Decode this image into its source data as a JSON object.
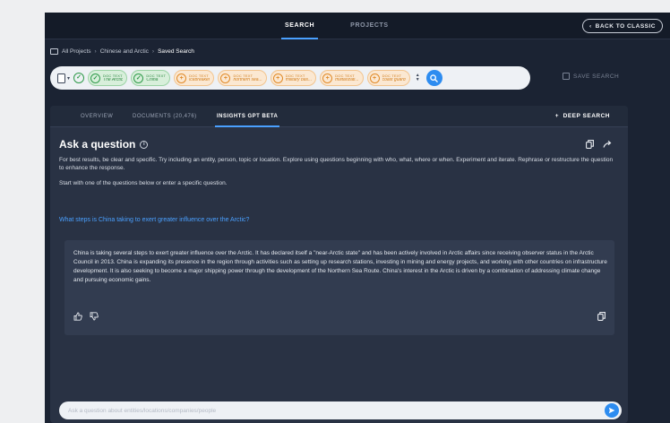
{
  "topnav": {
    "tabs": [
      {
        "label": "SEARCH",
        "active": true
      },
      {
        "label": "PROJECTS",
        "active": false
      }
    ],
    "back_to_classic": "BACK TO CLASSIC"
  },
  "breadcrumb": {
    "items": [
      "All Projects",
      "Chinese and Arctic",
      "Saved Search"
    ]
  },
  "querybar": {
    "chips": [
      {
        "category": "DOC TEXT",
        "value": "The Arctic",
        "color": "green"
      },
      {
        "category": "DOC TEXT",
        "value": "China",
        "color": "green"
      },
      {
        "category": "DOC TEXT",
        "value": "icebreaker",
        "color": "orange"
      },
      {
        "category": "DOC TEXT",
        "value": "northern sea...",
        "color": "orange"
      },
      {
        "category": "DOC TEXT",
        "value": "military bas...",
        "color": "orange"
      },
      {
        "category": "DOC TEXT",
        "value": "militarizati...",
        "color": "orange"
      },
      {
        "category": "DOC TEXT",
        "value": "coast guard",
        "color": "orange"
      }
    ],
    "save_search": "SAVE SEARCH"
  },
  "subtabs": [
    {
      "label": "OVERVIEW",
      "active": false
    },
    {
      "label": "DOCUMENTS (20,476)",
      "active": false
    },
    {
      "label": "INSIGHTS GPT BETA",
      "active": true
    }
  ],
  "deep_search": "DEEP SEARCH",
  "ask": {
    "title": "Ask a question",
    "intro": "For best results, be clear and specific. Try including an entity, person, topic or location. Explore using questions beginning with who, what, where or when. Experiment and iterate. Rephrase or restructure the question to enhance the response.",
    "start": "Start with one of the questions below or enter a specific question.",
    "suggested_question": "What steps is China taking to exert greater influence over the Arctic?",
    "answer": "China is taking several steps to exert greater influence over the Arctic. It has declared itself a \"near-Arctic state\" and has been actively involved in Arctic affairs since receiving observer status in the Arctic Council in 2013. China is expanding its presence in the region through activities such as setting up research stations, investing in mining and energy projects, and working with other countries on infrastructure development. It is also seeking to become a major shipping power through the development of the Northern Sea Route. China's interest in the Arctic is driven by a combination of addressing climate change and pursuing economic gains.",
    "prompt_placeholder": "Ask a question about entities/locations/companies/people"
  },
  "icons": {
    "accent": "#2d8cf0",
    "green_chip": "#2f9a4a",
    "orange_chip": "#e08a28"
  }
}
